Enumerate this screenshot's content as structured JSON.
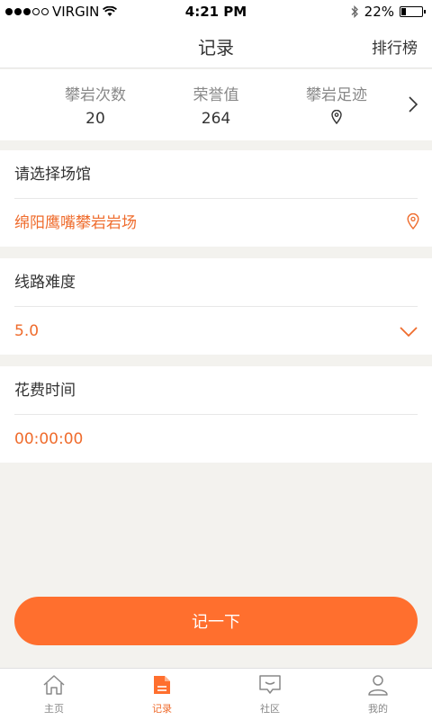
{
  "status": {
    "carrier": "VIRGIN",
    "time": "4:21 PM",
    "battery": "22%",
    "battery_level": 0.22
  },
  "nav": {
    "title": "记录",
    "rank": "排行榜"
  },
  "stats": [
    {
      "label": "攀岩次数",
      "value": "20"
    },
    {
      "label": "荣誉值",
      "value": "264"
    },
    {
      "label": "攀岩足迹",
      "icon": "location-pin-icon"
    }
  ],
  "venue": {
    "label": "请选择场馆",
    "value": "绵阳鹰嘴攀岩岩场"
  },
  "difficulty": {
    "label": "线路难度",
    "value": "5.0"
  },
  "duration": {
    "label": "花费时间",
    "value": "00:00:00"
  },
  "submit_label": "记一下",
  "tabs": [
    {
      "label": "主页",
      "icon": "home-icon"
    },
    {
      "label": "记录",
      "icon": "record-icon",
      "active": true
    },
    {
      "label": "社区",
      "icon": "community-icon"
    },
    {
      "label": "我的",
      "icon": "profile-icon"
    }
  ],
  "colors": {
    "accent": "#ff6f2e",
    "accent_text": "#ef6c2d",
    "background": "#f3f2ee"
  }
}
